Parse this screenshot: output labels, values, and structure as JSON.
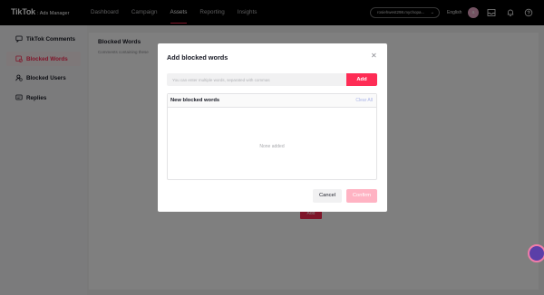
{
  "topbar": {
    "brand": "TikTok",
    "brand_sub": ": Ads Manager",
    "nav": [
      {
        "label": "Dashboard"
      },
      {
        "label": "Campaign"
      },
      {
        "label": "Assets"
      },
      {
        "label": "Reporting"
      },
      {
        "label": "Insights"
      }
    ],
    "account": "rosiehwest298.mychopa...",
    "language": "English",
    "avatar_letter": "a"
  },
  "sidebar": {
    "items": [
      {
        "label": "TikTok Comments",
        "icon": "comment-icon"
      },
      {
        "label": "Blocked Words",
        "icon": "blocked-words-icon"
      },
      {
        "label": "Blocked Users",
        "icon": "blocked-user-icon"
      },
      {
        "label": "Replies",
        "icon": "replies-icon"
      }
    ]
  },
  "content": {
    "title": "Blocked Words",
    "description": "Comments containing these",
    "button": "Add"
  },
  "modal": {
    "title": "Add blocked words",
    "input_placeholder": "You can enter multiple words, separated with commas",
    "add_label": "Add",
    "list_title": "New blocked words",
    "clear_all": "Clear All",
    "empty_text": "None added",
    "cancel_label": "Cancel",
    "confirm_label": "Confirm"
  },
  "colors": {
    "accent": "#fe2c55",
    "accent_disabled": "#ffb3c3",
    "link_disabled": "#aab4e8"
  }
}
